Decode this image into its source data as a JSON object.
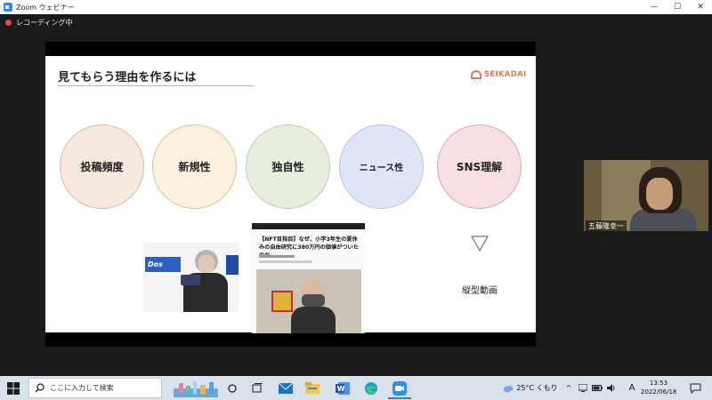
{
  "window": {
    "title": "Zoom ウェビナー",
    "minimize": "—",
    "maximize": "☐",
    "close": "✕"
  },
  "recording": {
    "label": "レコーディング中"
  },
  "slide": {
    "title": "見てもらう理由を作るには",
    "logo_text": "SEIKADAI",
    "circles": [
      {
        "label": "投稿頻度",
        "color": "#f8e9e0",
        "border": "#d9b8a5"
      },
      {
        "label": "新規性",
        "color": "#fbf1dc",
        "border": "#d8c39a"
      },
      {
        "label": "独自性",
        "color": "#e6eedd",
        "border": "#bfcfb0"
      },
      {
        "label": "ニュース性",
        "color": "#dfe6f8",
        "border": "#b6c2e2"
      },
      {
        "label": "SNS理解",
        "color": "#f8dfe2",
        "border": "#d9a8ae"
      }
    ],
    "article_headline": "【NFT目指目】なぜ、小学3年生の夏休みの自由研究に380万円の価値がついたのか",
    "vertical_video_label": "縦型動画"
  },
  "participant": {
    "name": "五藤隆幸一"
  },
  "taskbar": {
    "search_placeholder": "ここに入力して検索",
    "weather": "25°C くもり",
    "ime": "A",
    "time": "13:53",
    "date": "2022/06/18"
  },
  "colors": {
    "accent": "#e07a53",
    "zoom_blue": "#2d8cff"
  }
}
